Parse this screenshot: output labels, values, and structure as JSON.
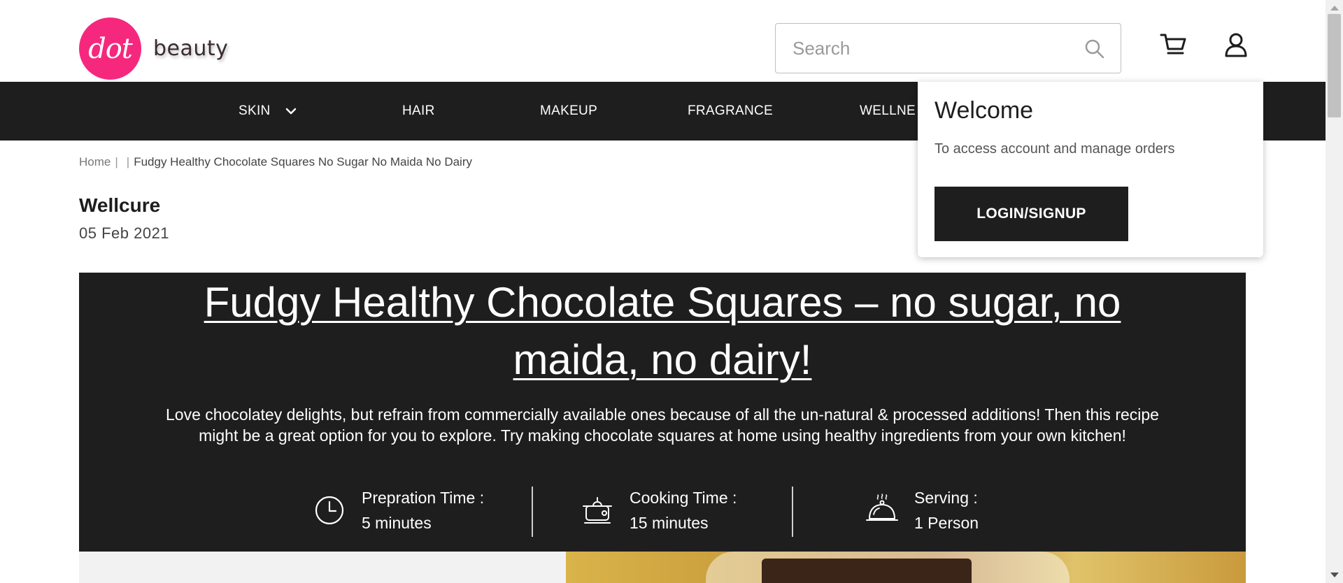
{
  "brand": {
    "logo_text": "dot",
    "word": "beauty",
    "accent_color": "#f5287e"
  },
  "search": {
    "placeholder": "Search",
    "value": "",
    "icon": "search-icon"
  },
  "header_icons": {
    "cart": "cart-icon",
    "user": "user-icon"
  },
  "nav": {
    "items": [
      {
        "label": "SKIN",
        "has_dropdown": true
      },
      {
        "label": "HAIR"
      },
      {
        "label": "MAKEUP"
      },
      {
        "label": "FRAGRANCE"
      },
      {
        "label": "WELLNE"
      }
    ],
    "background": "#1e1e1e"
  },
  "breadcrumb": {
    "home": "Home",
    "separator": "|",
    "current": "Fudgy Healthy Chocolate Squares No Sugar No Maida No Dairy"
  },
  "article": {
    "author": "Wellcure",
    "date": "05 Feb 2021",
    "title": "Fudgy Healthy Chocolate Squares – no sugar, no maida, no dairy!",
    "description": "Love chocolatey delights, but refrain from commercially available ones because of all the un-natural & processed additions! Then this recipe might be a great option for you to explore. Try making chocolate squares at home using healthy ingredients from your own kitchen!",
    "stats": [
      {
        "label": "Prepration Time :",
        "value": "5 minutes",
        "icon": "clock-icon"
      },
      {
        "label": "Cooking Time :",
        "value": "15 minutes",
        "icon": "cooking-pot-icon"
      },
      {
        "label": "Serving :",
        "value": "1 Person",
        "icon": "serving-cloche-icon"
      }
    ]
  },
  "account_popup": {
    "title": "Welcome",
    "subtitle": "To access account and manage orders",
    "button": "LOGIN/SIGNUP"
  }
}
